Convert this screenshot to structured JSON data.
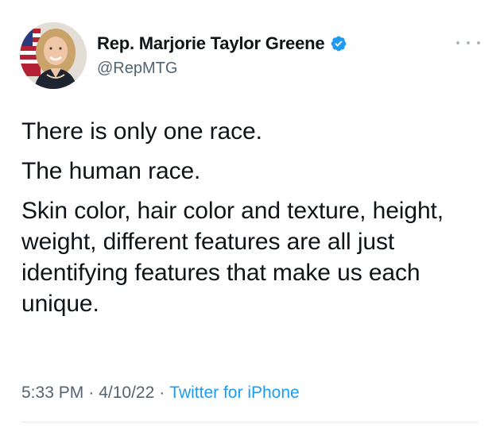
{
  "author": {
    "display_name": "Rep. Marjorie Taylor Greene",
    "handle": "@RepMTG",
    "verified": true,
    "avatar_icon": "profile-photo"
  },
  "more_icon": "more-options-icon",
  "tweet": {
    "paragraphs": [
      "There is only one race.",
      "The human race.",
      "Skin color, hair color and texture, height, weight, different features are all just identifying features that make us each unique."
    ]
  },
  "meta": {
    "time": "5:33 PM",
    "separator": "·",
    "date": "4/10/22",
    "source": "Twitter for iPhone"
  },
  "colors": {
    "text": "#0f1419",
    "secondary": "#536471",
    "link": "#1d9bf0",
    "verified_badge": "#1d9bf0",
    "divider": "#e6ecf0"
  }
}
